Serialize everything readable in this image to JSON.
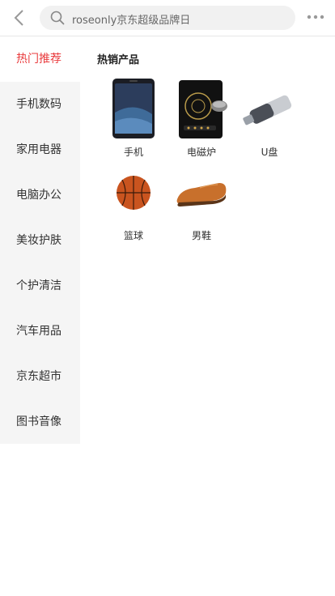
{
  "header": {
    "search_placeholder": "roseonly京东超级品牌日"
  },
  "sidebar": {
    "items": [
      {
        "label": "热门推荐",
        "active": true
      },
      {
        "label": "手机数码"
      },
      {
        "label": "家用电器"
      },
      {
        "label": "电脑办公"
      },
      {
        "label": "美妆护肤"
      },
      {
        "label": "个护清洁"
      },
      {
        "label": "汽车用品"
      },
      {
        "label": "京东超市"
      },
      {
        "label": "图书音像"
      }
    ]
  },
  "main": {
    "section_title": "热销产品",
    "products": [
      {
        "label": "手机"
      },
      {
        "label": "电磁炉"
      },
      {
        "label": "U盘"
      },
      {
        "label": "篮球"
      },
      {
        "label": "男鞋"
      }
    ]
  },
  "icons": {
    "back": "chevron-left-icon",
    "search": "search-icon",
    "more": "more-icon"
  },
  "colors": {
    "accent": "#e93b3d",
    "sidebar_bg": "#f5f5f5",
    "search_bg": "#f1f1f1"
  }
}
